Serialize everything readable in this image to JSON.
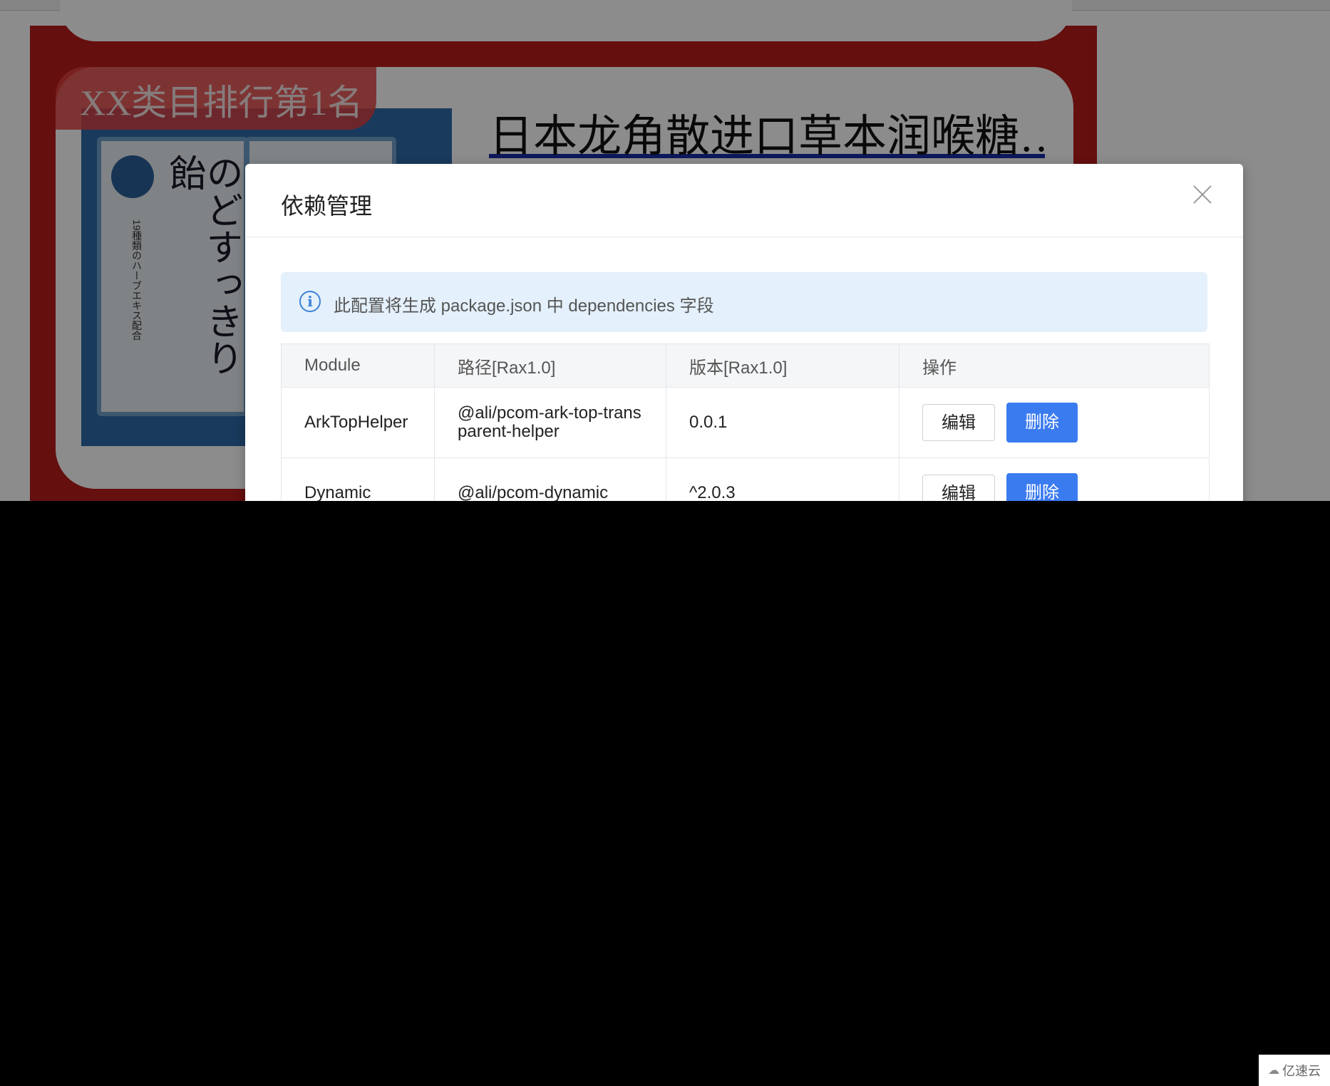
{
  "background_page": {
    "rank_badge": "XX类目排行第1名",
    "product_title": "日本龙角散进口草本润喉糖…",
    "package_text": "のどすっきり飴",
    "package_small": "19種類のハーブエキス配合"
  },
  "modal": {
    "title": "依赖管理",
    "alert": {
      "icon": "info-icon",
      "text": "此配置将生成 package.json 中 dependencies 字段"
    },
    "table": {
      "headers": [
        "Module",
        "路径[Rax1.0]",
        "版本[Rax1.0]",
        "操作"
      ],
      "rows": [
        {
          "module": "ArkTopHelper",
          "path": "@ali/pcom-ark-top-transparent-helper",
          "version": "0.0.1",
          "edit": "编辑",
          "delete": "删除"
        },
        {
          "module": "Dynamic",
          "path": "@ali/pcom-dynamic",
          "version": "^2.0.3",
          "edit": "编辑",
          "delete": "删除"
        }
      ]
    }
  },
  "watermark": "亿速云",
  "colors": {
    "primary": "#3b7bf0",
    "alert_bg": "#e4f0fb",
    "banner_red": "#b81c1c"
  }
}
